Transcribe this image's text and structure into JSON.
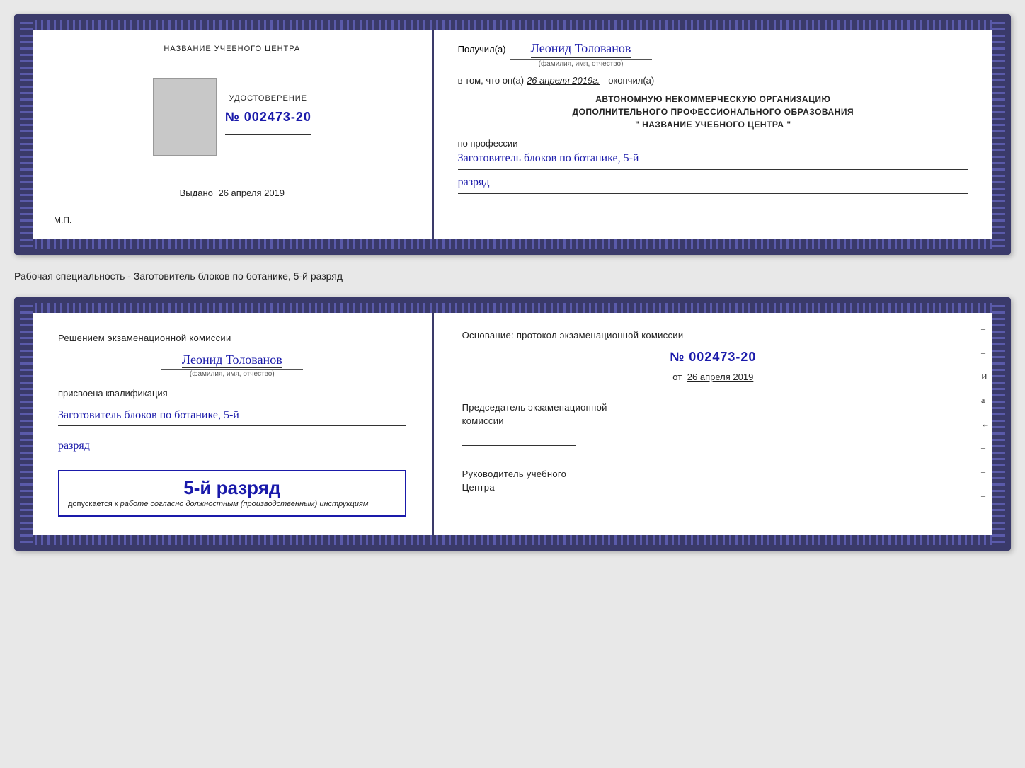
{
  "doc1": {
    "left": {
      "org_label": "НАЗВАНИЕ УЧЕБНОГО ЦЕНТРА",
      "cert_label": "УДОСТОВЕРЕНИЕ",
      "cert_number": "№ 002473-20",
      "issued_label": "Выдано",
      "issued_date": "26 апреля 2019",
      "mp_label": "М.П."
    },
    "right": {
      "received_prefix": "Получил(а)",
      "recipient_name": "Леонид Толованов",
      "recipient_caption": "(фамилия, имя, отчество)",
      "date_prefix": "в том, что он(а)",
      "date_value": "26 апреля 2019г.",
      "date_suffix": "окончил(а)",
      "org_line1": "АВТОНОМНУЮ НЕКОММЕРЧЕСКУЮ ОРГАНИЗАЦИЮ",
      "org_line2": "ДОПОЛНИТЕЛЬНОГО ПРОФЕССИОНАЛЬНОГО ОБРАЗОВАНИЯ",
      "org_line3": "\"   НАЗВАНИЕ УЧЕБНОГО ЦЕНТРА   \"",
      "profession_label": "по профессии",
      "profession_value": "Заготовитель блоков по ботанике, 5-й",
      "razryad_value": "разряд"
    }
  },
  "specialty_caption": "Рабочая специальность - Заготовитель блоков по ботанике, 5-й разряд",
  "doc2": {
    "left": {
      "decision_text": "Решением экзаменационной комиссии",
      "person_name": "Леонид Толованов",
      "fio_caption": "(фамилия, имя, отчество)",
      "qualification_label": "присвоена квалификация",
      "profession_value": "Заготовитель блоков по ботанике, 5-й",
      "razryad_value": "разряд",
      "stamp_grade": "5-й разряд",
      "stamp_caption_prefix": "допускается к",
      "stamp_caption_italic": "работе согласно должностным (производственным) инструкциям"
    },
    "right": {
      "basis_label": "Основание: протокол экзаменационной комиссии",
      "protocol_number": "№  002473-20",
      "date_prefix": "от",
      "date_value": "26 апреля 2019",
      "chairman_label1": "Председатель экзаменационной",
      "chairman_label2": "комиссии",
      "director_label1": "Руководитель учебного",
      "director_label2": "Центра"
    }
  }
}
